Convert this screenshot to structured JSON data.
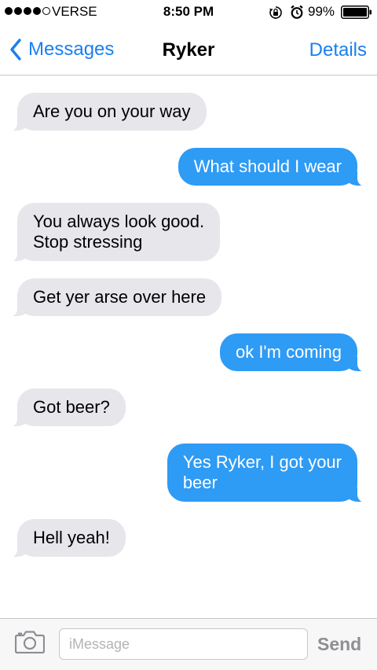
{
  "status_bar": {
    "carrier": "VERSE",
    "time": "8:50 PM",
    "battery": "99%"
  },
  "nav": {
    "back_label": "Messages",
    "title": "Ryker",
    "details_label": "Details"
  },
  "messages": [
    {
      "direction": "incoming",
      "text": "Are you on your way"
    },
    {
      "direction": "outgoing",
      "text": "What should I wear"
    },
    {
      "direction": "incoming",
      "text": "You always look good.\nStop stressing"
    },
    {
      "direction": "incoming",
      "text": "Get yer arse over here"
    },
    {
      "direction": "outgoing",
      "text": "ok I'm coming"
    },
    {
      "direction": "incoming",
      "text": "Got beer?"
    },
    {
      "direction": "outgoing",
      "text": "Yes Ryker, I got your\nbeer"
    },
    {
      "direction": "incoming",
      "text": "Hell yeah!"
    }
  ],
  "composer": {
    "placeholder": "iMessage",
    "value": "",
    "send_label": "Send"
  },
  "colors": {
    "accent": "#1a7ff0",
    "outgoing_bubble": "#2e9bf5",
    "incoming_bubble": "#e6e6eb"
  },
  "icons": {
    "back": "chevron-left-icon",
    "camera": "camera-icon",
    "orientation_lock": "orientation-lock-icon",
    "alarm": "alarm-icon",
    "battery": "battery-icon"
  }
}
